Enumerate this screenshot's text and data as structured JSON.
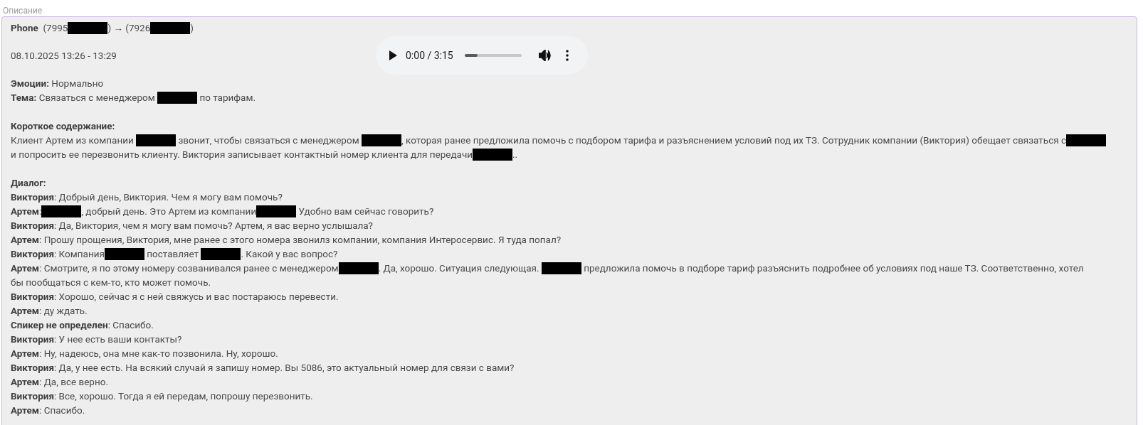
{
  "field_label": "Описание",
  "header": [
    {
      "kind": "text",
      "text": "**Phone**  (7995"
    },
    {
      "kind": "redacted"
    },
    {
      "kind": "text",
      "text": ") → (7926"
    },
    {
      "kind": "redacted"
    },
    {
      "kind": "text",
      "text": ")"
    }
  ],
  "date": "08.10.2025 13:26 - 13:29",
  "audio": {
    "time": "0:00 / 3:15",
    "level": 0.23
  },
  "emotion": [
    {
      "kind": "text",
      "text": "**Эмоции:** Нормально"
    }
  ],
  "topic": [
    {
      "kind": "text",
      "text": "**Тема:** Связаться с менеджером "
    },
    {
      "kind": "redacted"
    },
    {
      "kind": "text",
      "text": " по тарифам."
    }
  ],
  "summary_title": "Короткое содержание:",
  "summary": [
    [
      {
        "kind": "text",
        "text": "Клиент Артем из компании "
      },
      {
        "kind": "redacted"
      },
      {
        "kind": "text",
        "text": " звонит, чтобы связаться с менеджером "
      },
      {
        "kind": "redacted"
      },
      {
        "kind": "text",
        "text": ", которая ранее предложила помочь с подбором тарифа и разъяснением условий под их ТЗ. Сотрудник компании (Виктория) обещает связаться с"
      },
      {
        "kind": "redacted"
      }
    ],
    [
      {
        "kind": "text",
        "text": "и попросить ее перезвонить клиенту. Виктория записывает контактный номер клиента для передачи"
      },
      {
        "kind": "redacted"
      },
      {
        "kind": "text",
        "text": ".."
      }
    ]
  ],
  "dialog_title": "Диалог:",
  "dialog": [
    [
      {
        "kind": "text",
        "text": "**Виктория**: Добрый день, Виктория. Чем я могу вам помочь?"
      }
    ],
    [
      {
        "kind": "text",
        "text": "**Артем**:"
      },
      {
        "kind": "redacted"
      },
      {
        "kind": "text",
        "text": ", добрый день. Это Артем из компании"
      },
      {
        "kind": "redacted"
      },
      {
        "kind": "text",
        "text": " Удобно вам сейчас говорить?"
      }
    ],
    [
      {
        "kind": "text",
        "text": "**Виктория**: Да, Виктория, чем я могу вам помочь? Артем, я вас верно услышала?"
      }
    ],
    [
      {
        "kind": "text",
        "text": "**Артем**: Прошу прощения, Виктория, мне ранее с этого номера звонилз компании, компания Интеросервис. Я туда попал?"
      }
    ],
    [
      {
        "kind": "text",
        "text": "**Виктория**: Компания"
      },
      {
        "kind": "redacted"
      },
      {
        "kind": "text",
        "text": " поставляет "
      },
      {
        "kind": "redacted"
      },
      {
        "kind": "text",
        "text": ". Какой у вас вопрос?"
      }
    ],
    [
      {
        "kind": "text",
        "text": "**Артем**: Смотрите, я по этому номеру созванивался ранее с менеджером"
      },
      {
        "kind": "redacted"
      },
      {
        "kind": "text",
        "text": ". Да, хорошо. Ситуация следующая. "
      },
      {
        "kind": "redacted"
      },
      {
        "kind": "text",
        "text": " предложила помочь в подборе тариф разъяснить подробнее об условиях под наше ТЗ. Соответственно, хотел"
      }
    ],
    [
      {
        "kind": "text",
        "text": "бы пообщаться с кем-то, кто может помочь."
      }
    ],
    [
      {
        "kind": "text",
        "text": "**Виктория**: Хорошо, сейчас я с ней свяжусь и вас постараюсь перевести."
      }
    ],
    [
      {
        "kind": "text",
        "text": "**Артем**: ду ждать."
      }
    ],
    [
      {
        "kind": "text",
        "text": "**Спикер не определен**: Спасибо."
      }
    ],
    [
      {
        "kind": "text",
        "text": "**Виктория**: У нее есть ваши контакты?"
      }
    ],
    [
      {
        "kind": "text",
        "text": "**Артем**: Ну, надеюсь, она мне как-то позвонила. Ну, хорошо."
      }
    ],
    [
      {
        "kind": "text",
        "text": "**Виктория**: Да, у нее есть. На всякий случай я запишу номер. Вы 5086, это актуальный номер для связи с вами?"
      }
    ],
    [
      {
        "kind": "text",
        "text": "**Артем**: Да, все верно."
      }
    ],
    [
      {
        "kind": "text",
        "text": "**Виктория**: Все, хорошо. Тогда я ей передам, попрошу перезвонить."
      }
    ],
    [
      {
        "kind": "text",
        "text": "**Артем**: Спасибо."
      }
    ]
  ]
}
